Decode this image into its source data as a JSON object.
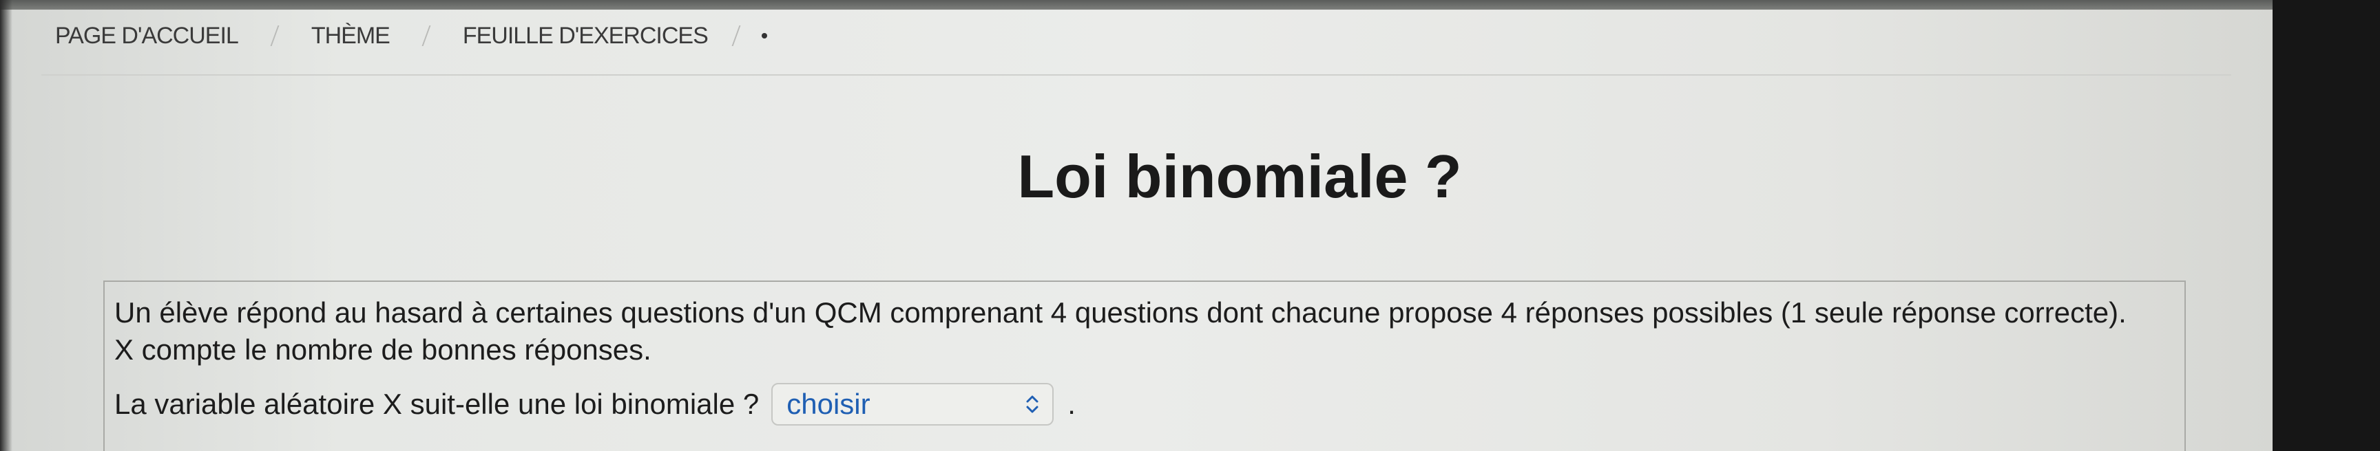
{
  "breadcrumb": {
    "items": [
      "PAGE D'ACCUEIL",
      "THÈME",
      "FEUILLE D'EXERCICES"
    ]
  },
  "page": {
    "title": "Loi binomiale ?"
  },
  "exercise": {
    "statement": "Un élève répond au hasard à certaines questions d'un QCM comprenant 4 questions dont chacune propose 4 réponses possibles (1 seule réponse correcte). X compte le nombre de bonnes réponses.",
    "question": "La variable aléatoire X suit-elle une loi binomiale ?",
    "select_value": "choisir",
    "trailing": "."
  },
  "colors": {
    "select_text": "#1f5fb3"
  }
}
